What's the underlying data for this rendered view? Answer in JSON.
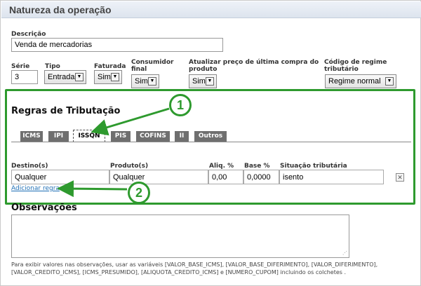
{
  "header": {
    "title": "Natureza da operação"
  },
  "descricao": {
    "label": "Descrição",
    "value": "Venda de mercadorias"
  },
  "serie": {
    "label": "Série",
    "value": "3"
  },
  "tipo": {
    "label": "Tipo",
    "value": "Entrada"
  },
  "faturada": {
    "label": "Faturada",
    "value": "Sim"
  },
  "consumidor": {
    "label_line1": "Consumidor",
    "label_line2": "final",
    "value": "Sim"
  },
  "atualizar": {
    "label_line1": "Atualizar preço de última compra do",
    "label_line2": "produto",
    "value": "Sim"
  },
  "regime": {
    "label_line1": "Código de regime",
    "label_line2": "tributário",
    "value": "Regime normal"
  },
  "regras": {
    "title": "Regras de Tributação",
    "tabs": [
      "ICMS",
      "IPI",
      "ISSQN",
      "PIS",
      "COFINS",
      "II",
      "Outros"
    ],
    "active_tab": "ISSQN",
    "columns": [
      "Destino(s)",
      "Produto(s)",
      "Aliq. %",
      "Base %",
      "Situação tributária"
    ],
    "row": [
      "Qualquer",
      "Qualquer",
      "0,00",
      "0,0000",
      "isento"
    ],
    "add_rule": "Adicionar regra"
  },
  "observacoes": {
    "title": "Observações",
    "help_line1": "Para exibir valores nas observações, usar as variáveis [VALOR_BASE_ICMS], [VALOR_BASE_DIFERIMENTO], [VALOR_DIFERIMENTO],",
    "help_line2": "[VALOR_CREDITO_ICMS], [ICMS_PRESUMIDO], [ALIQUOTA_CREDITO_ICMS] e [NUMERO_CUPOM] incluindo os colchetes ."
  },
  "callouts": {
    "one": "1",
    "two": "2"
  },
  "colors": {
    "callout_green": "#2e9a2e",
    "tab_gray": "#6f6f6f",
    "link_blue": "#1f6fb5"
  }
}
